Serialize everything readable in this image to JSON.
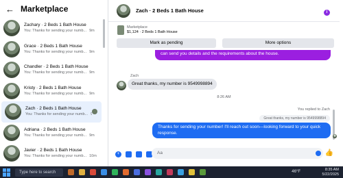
{
  "left": {
    "back_glyph": "←",
    "title": "Marketplace",
    "items": [
      {
        "name": "Zachary · 2 Beds 1 Bath House",
        "sub": "You: Thanks for sending your numb...",
        "time": "9m",
        "active": false
      },
      {
        "name": "Grace · 2 Beds 1 Bath House",
        "sub": "You: Thanks for sending your numb...",
        "time": "9m",
        "active": false
      },
      {
        "name": "Chandler · 2 Beds 1 Bath House",
        "sub": "You: Thanks for sending your numb...",
        "time": "9m",
        "active": false
      },
      {
        "name": "Kristy · 2 Beds 1 Bath House",
        "sub": "You: Thanks for sending your numb...",
        "time": "9m",
        "active": false
      },
      {
        "name": "Zach · 2 Beds 1 Bath House",
        "sub": "You: Thanks for sending your numb...",
        "time": "9m",
        "active": true
      },
      {
        "name": "Adriana · 2 Beds 1 Bath House",
        "sub": "You: Thanks for sending your numb...",
        "time": "9m",
        "active": false
      },
      {
        "name": "Javier · 2 Beds 1 Bath House",
        "sub": "You: Thanks for sending your numb...",
        "time": "10m",
        "active": false
      }
    ]
  },
  "chat": {
    "title": "Zach · 2 Beds 1 Bath House",
    "info_glyph": "i",
    "marketplace_label": "Marketplace",
    "price_line": "$1,124 · 2 Beds 1 Bath House",
    "mark_pending": "Mark as pending",
    "more_options": "More options",
    "purple_partial": "can send you details and the requirements about the house.",
    "sender_label": "Zach",
    "incoming_text": "Great thanks, my number is 9549998894",
    "timestamp": "8:26 AM",
    "replied_label": "You replied to Zach",
    "quoted_text": "Great thanks, my number is 9549998894",
    "outgoing_text": "Thanks for sending your number! I'll reach out soon—looking forward to your quick response.",
    "composer_placeholder": "Aa"
  },
  "taskbar": {
    "search_placeholder": "Type here to search",
    "temperature": "46°F",
    "time": "8:35 AM",
    "date": "5/22/2025"
  },
  "colors": {
    "accent_blue": "#1e6cf2",
    "purple": "#9b1fe0",
    "taskbar": "#1c2230"
  }
}
